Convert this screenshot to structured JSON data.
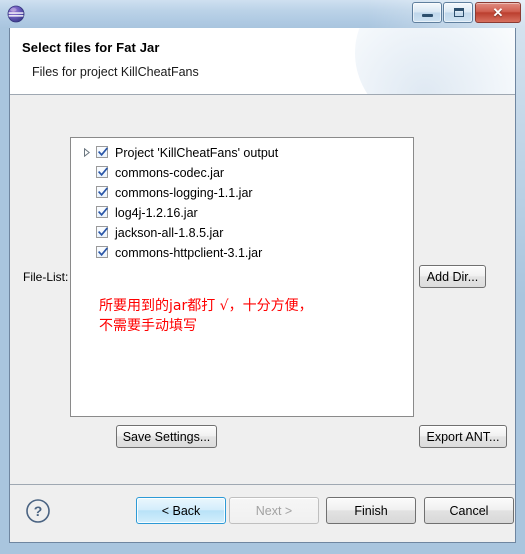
{
  "window": {
    "titlebar_text": "",
    "app_icon": "eclipse-globe-icon",
    "minimize_label": "",
    "maximize_label": "",
    "close_label": "✕"
  },
  "header": {
    "title": "Select files for Fat Jar",
    "subtitle": "Files for project KillCheatFans"
  },
  "body": {
    "file_list_label": "File-List:",
    "file_list": [
      {
        "label": "Project 'KillCheatFans' output",
        "checked": true,
        "expandable": true
      },
      {
        "label": "commons-codec.jar",
        "checked": true,
        "expandable": false
      },
      {
        "label": "commons-logging-1.1.jar",
        "checked": true,
        "expandable": false
      },
      {
        "label": "log4j-1.2.16.jar",
        "checked": true,
        "expandable": false
      },
      {
        "label": "jackson-all-1.8.5.jar",
        "checked": true,
        "expandable": false
      },
      {
        "label": "commons-httpclient-3.1.jar",
        "checked": true,
        "expandable": false
      }
    ],
    "annotation": "所要用到的jar都打 √，十分方便，\n不需要手动填写",
    "annotation_color": "#ff0000",
    "add_dir_label": "Add Dir...",
    "save_settings_label": "Save Settings...",
    "export_ant_label": "Export ANT..."
  },
  "footer": {
    "help_label": "?",
    "back_label": "< Back",
    "next_label": "Next >",
    "finish_label": "Finish",
    "cancel_label": "Cancel"
  },
  "colors": {
    "titlebar": "#a9c5de",
    "client_bg": "#efefef",
    "header_bg": "#ffffff",
    "focus_border": "#2c9ad6",
    "close_button": "#bb3f2f",
    "annotation": "#ff0000"
  }
}
